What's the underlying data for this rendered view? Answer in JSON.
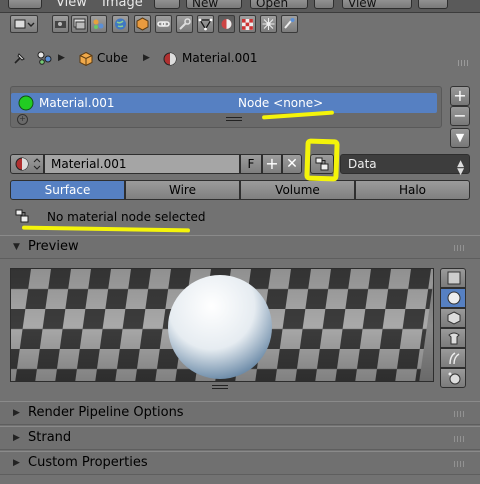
{
  "top_menu": {
    "view": "View",
    "image": "Image",
    "new_btn": "New",
    "open_btn": "Open",
    "view_select": "View"
  },
  "breadcrumb": {
    "object": "Cube",
    "material": "Material.001"
  },
  "slot_list": {
    "slot_name": "Material.001",
    "node_label": "Node <none>"
  },
  "side_buttons": {
    "add": "+",
    "remove": "−"
  },
  "id_row": {
    "name": "Material.001",
    "fake_user": "F",
    "link_select": "Data"
  },
  "tabs": [
    {
      "label": "Surface",
      "selected": true
    },
    {
      "label": "Wire",
      "selected": false
    },
    {
      "label": "Volume",
      "selected": false
    },
    {
      "label": "Halo",
      "selected": false
    }
  ],
  "node_status": "No material node selected",
  "panels": {
    "preview": "Preview",
    "render_pipeline": "Render Pipeline Options",
    "strand": "Strand",
    "custom_props": "Custom Properties"
  },
  "colors": {
    "selection_blue": "#5680c2",
    "annotation_yellow": "#f4f40a",
    "slot_green": "#22cc22"
  },
  "preview_types": [
    "flat-icon",
    "sphere-icon",
    "cube-icon",
    "monkey-icon",
    "hair-icon",
    "sphere-world-icon"
  ],
  "preview_selected": "sphere-icon"
}
